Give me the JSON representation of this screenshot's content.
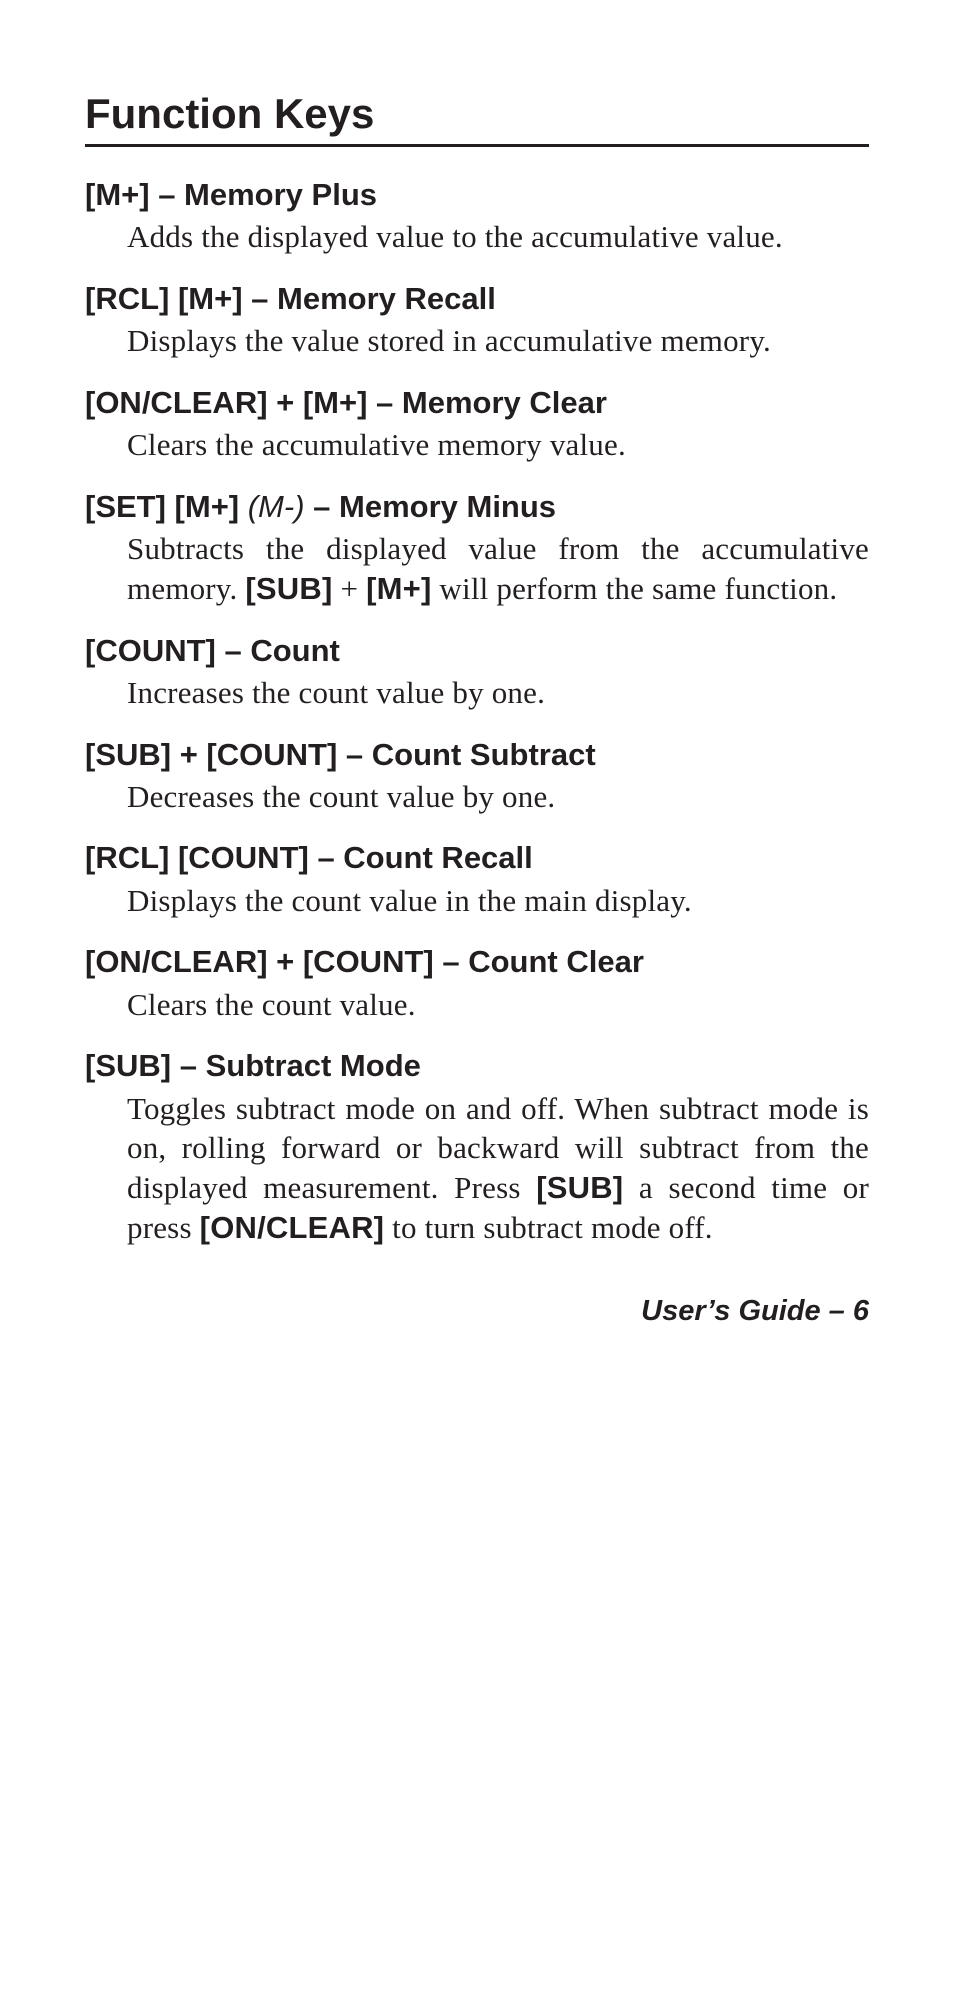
{
  "section_title": "Function Keys",
  "entries": [
    {
      "keys": "[M+]",
      "sep": " – ",
      "title": "Memory Plus",
      "desc_parts": [
        {
          "t": "Adds the displayed value to the accumulative value."
        }
      ]
    },
    {
      "keys": "[RCL] [M+]",
      "sep": " – ",
      "title": "Memory Recall",
      "desc_parts": [
        {
          "t": "Displays the value stored in accumulative memory."
        }
      ]
    },
    {
      "keys": "[ON/CLEAR] + [M+]",
      "sep": " – ",
      "title": "Memory Clear",
      "desc_parts": [
        {
          "t": "Clears the accumulative memory value."
        }
      ]
    },
    {
      "keys": "[SET] [M+]",
      "alt": " (M-) ",
      "sep": "– ",
      "title": "Memory Minus",
      "desc_parts": [
        {
          "t": "Subtracts the displayed value from the accumulative memory. "
        },
        {
          "t": "[SUB]",
          "bold": true
        },
        {
          "t": " + "
        },
        {
          "t": "[M+]",
          "bold": true
        },
        {
          "t": " will perform the same function."
        }
      ]
    },
    {
      "keys": "[COUNT]",
      "sep": " – ",
      "title": "Count",
      "desc_parts": [
        {
          "t": "Increases the count value by one."
        }
      ]
    },
    {
      "keys": "[SUB] + [COUNT]",
      "sep": " – ",
      "title": "Count Subtract",
      "desc_parts": [
        {
          "t": "Decreases the count value by one."
        }
      ]
    },
    {
      "keys": "[RCL] [COUNT]",
      "sep": " – ",
      "title": "Count Recall",
      "desc_parts": [
        {
          "t": "Displays the count value in the main display."
        }
      ]
    },
    {
      "keys": "[ON/CLEAR] + [COUNT]",
      "sep": " – ",
      "title": "Count Clear",
      "desc_parts": [
        {
          "t": "Clears the count value."
        }
      ]
    },
    {
      "keys": "[SUB]",
      "sep": " – ",
      "title": "Subtract Mode",
      "desc_parts": [
        {
          "t": "Toggles subtract mode on and off. When subtract mode is on, rolling forward or backward will subtract from the displayed measurement. Press "
        },
        {
          "t": "[SUB]",
          "bold": true
        },
        {
          "t": " a second time or press "
        },
        {
          "t": "[ON/CLEAR]",
          "bold": true
        },
        {
          "t": " to turn subtract mode off."
        }
      ]
    }
  ],
  "footer": "User’s Guide – 6"
}
